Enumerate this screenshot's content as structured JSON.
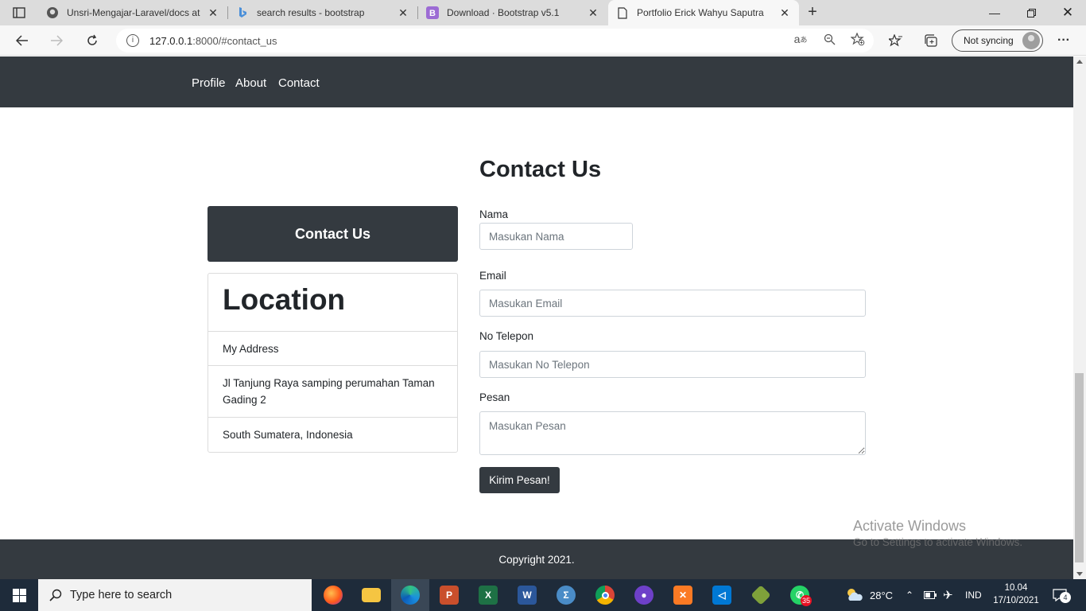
{
  "browser": {
    "tabs": [
      {
        "title": "Unsri-Mengajar-Laravel/docs at",
        "icon": "github-icon"
      },
      {
        "title": "search results - bootstrap",
        "icon": "bing-icon"
      },
      {
        "title": "Download · Bootstrap v5.1",
        "icon": "bootstrap-icon"
      },
      {
        "title": "Portfolio Erick Wahyu Saputra",
        "icon": "page-icon"
      }
    ],
    "url_host": "127.0.0.1",
    "url_rest": ":8000/#contact_us",
    "sync_label": "Not syncing"
  },
  "nav": {
    "links": [
      "Profile",
      "About",
      "Contact"
    ]
  },
  "contact": {
    "title": "Contact Us",
    "card_title": "Contact Us",
    "location": {
      "heading": "Location",
      "items": [
        "My Address",
        "Jl Tanjung Raya samping perumahan Taman Gading 2",
        "South Sumatera, Indonesia"
      ]
    },
    "form": {
      "nama_label": "Nama",
      "nama_placeholder": "Masukan Nama",
      "email_label": "Email",
      "email_placeholder": "Masukan Email",
      "telepon_label": "No Telepon",
      "telepon_placeholder": "Masukan No Telepon",
      "pesan_label": "Pesan",
      "pesan_placeholder": "Masukan Pesan",
      "submit_label": "Kirim Pesan!"
    }
  },
  "footer": {
    "copyright": "Copyright 2021."
  },
  "watermark": {
    "line1": "Activate Windows",
    "line2": "Go to Settings to activate Windows."
  },
  "taskbar": {
    "search_placeholder": "Type here to search",
    "weather": "28°C",
    "language": "IND",
    "time": "10.04",
    "date": "17/10/2021",
    "whatsapp_badge": "35",
    "notifications": "4"
  },
  "colors": {
    "dark": "#343a40",
    "taskbar": "#1e2b3a"
  }
}
